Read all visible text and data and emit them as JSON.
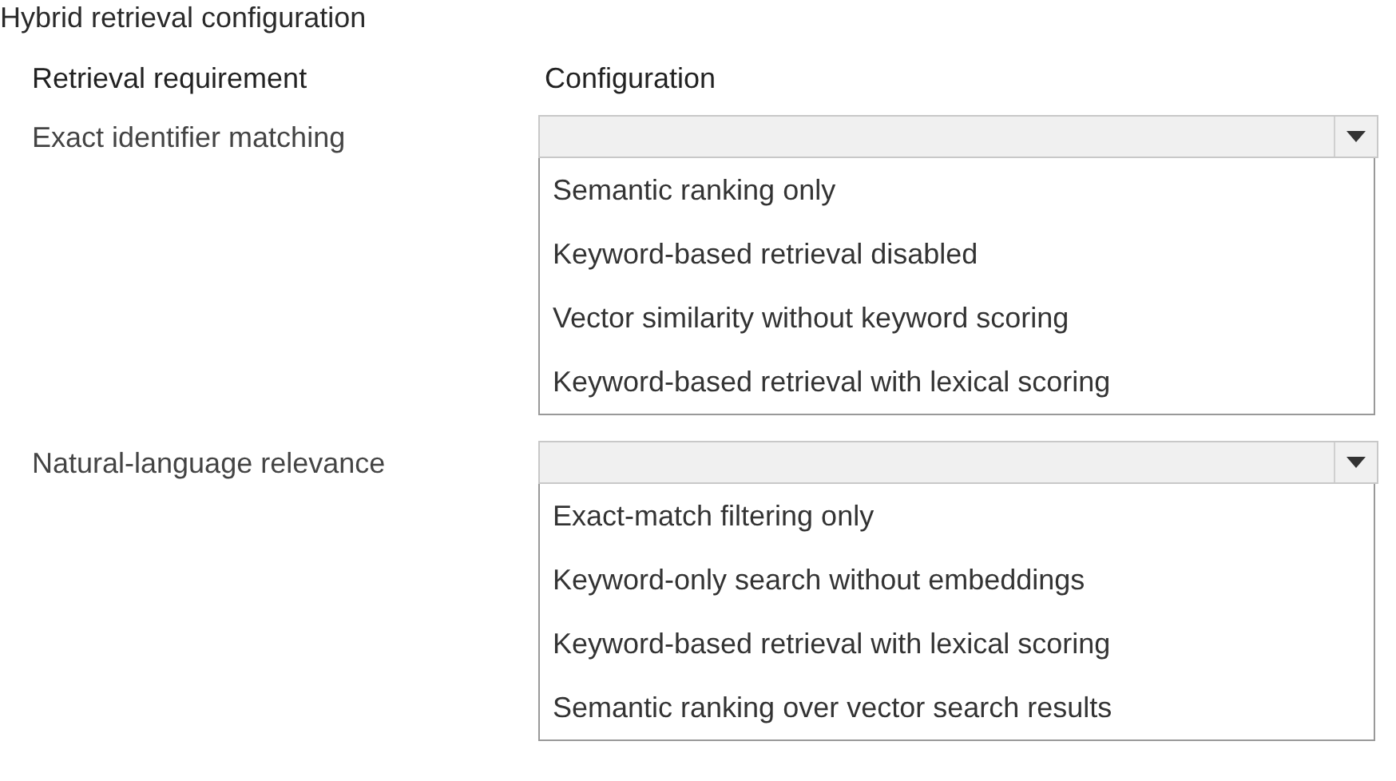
{
  "title": "Hybrid retrieval configuration",
  "table": {
    "columns": [
      "Retrieval requirement",
      "Configuration"
    ],
    "rows": [
      {
        "requirement": "Exact identifier matching",
        "dropdown": {
          "expanded": true,
          "options": [
            "Semantic ranking only",
            "Keyword-based retrieval disabled",
            "Vector similarity without keyword scoring",
            "Keyword-based retrieval with lexical scoring"
          ]
        }
      },
      {
        "requirement": "Natural-language relevance",
        "dropdown": {
          "expanded": true,
          "options": [
            "Exact-match filtering only",
            "Keyword-only search without embeddings",
            "Keyword-based retrieval with lexical scoring",
            "Semantic ranking over vector search results"
          ]
        }
      }
    ]
  }
}
